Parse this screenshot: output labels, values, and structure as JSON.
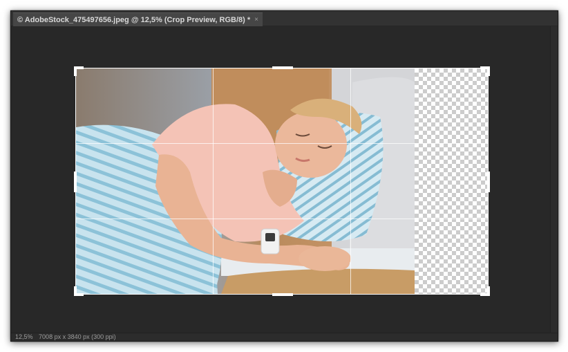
{
  "document_tab": {
    "title": "© AdobeStock_475497656.jpeg @ 12,5% (Crop Preview, RGB/8) *",
    "close_glyph": "×"
  },
  "status_bar": {
    "zoom": "12,5%",
    "doc_info": "7008 px x 3840 px (300 ppi)"
  },
  "canvas": {
    "background": "#282828",
    "photo_description_colors": {
      "pillow": "#a8d4e6",
      "shirt": "#f5c2b8",
      "skin": "#e6b496",
      "wood": "#c79a62"
    }
  },
  "crop_tool": {
    "overlay": "rule-of-thirds",
    "transparent_area": "checkerboard"
  }
}
